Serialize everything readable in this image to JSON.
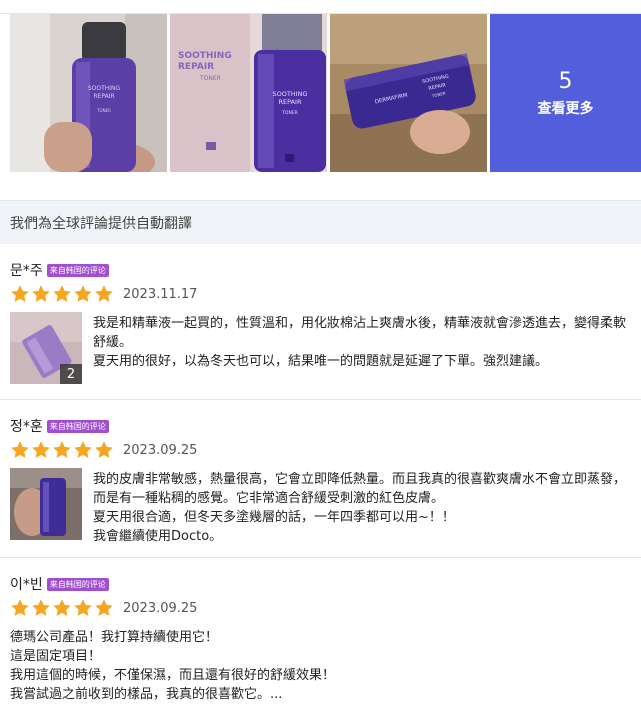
{
  "gallery": {
    "more_count": "5",
    "more_label": "查看更多",
    "photo_texts": {
      "p1": [
        "SOOTHING",
        "REPAIR",
        "TONER"
      ],
      "p2": [
        "SOOTHING",
        "REPAIR",
        "TONER"
      ],
      "p2b": [
        "SOOTHING",
        "REPAIR",
        "TONER"
      ],
      "p3": [
        "SOOTHING",
        "REPAIR",
        "TONER"
      ],
      "p3_brand": "DERMAFIRM"
    }
  },
  "translate_notice": "我們為全球評論提供自動翻譯",
  "reviews": [
    {
      "name": "문*주",
      "badge": "来自韩国的评论",
      "rating": 5,
      "date": "2023.11.17",
      "image_count": "2",
      "text": [
        "我是和精華液一起買的，性質溫和，用化妝棉沾上爽膚水後，精華液就會滲透進去，變得柔軟",
        "舒緩。",
        "夏天用的很好，以為冬天也可以，結果唯一的問題就是延遲了下單。強烈建議。"
      ]
    },
    {
      "name": "정*훈",
      "badge": "来自韩国的评论",
      "rating": 5,
      "date": "2023.09.25",
      "text": [
        "我的皮膚非常敏感，熱量很高，它會立即降低熱量。而且我真的很喜歡爽膚水不會立即蒸發，",
        "而是有一種粘稠的感覺。它非常適合舒緩受刺激的紅色皮膚。",
        "夏天用很合適，但冬天多塗幾層的話，一年四季都可以用~！！",
        "我會繼續使用Docto。"
      ]
    },
    {
      "name": "이*빈",
      "badge": "来自韩国的评论",
      "rating": 5,
      "date": "2023.09.25",
      "text": [
        "德瑪公司產品！我打算持續使用它！",
        "這是固定項目！",
        "我用這個的時候，不僅保濕，而且還有很好的舒緩效果！",
        "我嘗試過之前收到的樣品，我真的很喜歡它。..."
      ]
    }
  ],
  "colors": {
    "star": "#f5a623",
    "badge": "#a24fcf",
    "more_overlay": "#4d5fe0",
    "translate_bg": "#f0f3f7"
  }
}
